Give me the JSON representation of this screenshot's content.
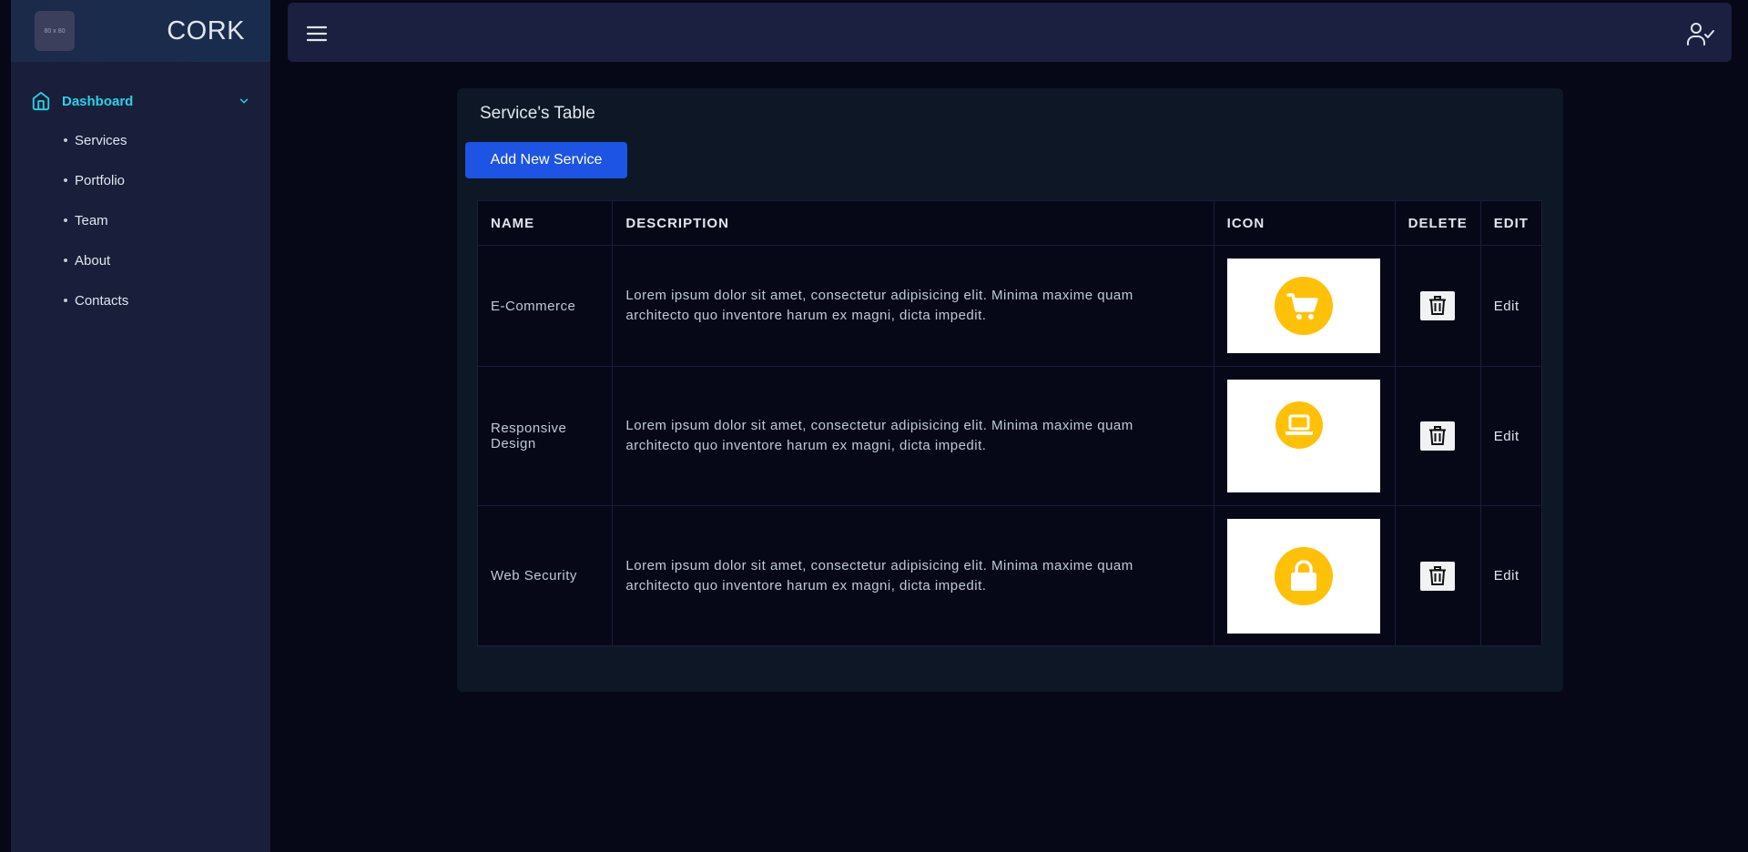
{
  "brand": {
    "logo_text": "80 x 80",
    "name": "CORK"
  },
  "sidebar": {
    "section_label": "Dashboard",
    "items": [
      {
        "label": "Services"
      },
      {
        "label": "Portfolio"
      },
      {
        "label": "Team"
      },
      {
        "label": "About"
      },
      {
        "label": "Contacts"
      }
    ]
  },
  "main": {
    "card_title": "Service's Table",
    "add_button_label": "Add New Service",
    "table": {
      "headers": [
        "NAME",
        "DESCRIPTION",
        "ICON",
        "DELETE",
        "EDIT"
      ],
      "rows": [
        {
          "name": "E-Commerce",
          "description": "Lorem ipsum dolor sit amet, consectetur adipisicing elit. Minima maxime quam architecto quo inventore harum ex magni, dicta impedit.",
          "icon": "shopping-cart-icon",
          "edit_label": "Edit"
        },
        {
          "name": "Responsive Design",
          "description": "Lorem ipsum dolor sit amet, consectetur adipisicing elit. Minima maxime quam architecto quo inventore harum ex magni, dicta impedit.",
          "icon": "laptop-icon",
          "edit_label": "Edit"
        },
        {
          "name": "Web Security",
          "description": "Lorem ipsum dolor sit amet, consectetur adipisicing elit. Minima maxime quam architecto quo inventore harum ex magni, dicta impedit.",
          "icon": "lock-icon",
          "edit_label": "Edit"
        }
      ]
    }
  },
  "colors": {
    "background": "#060818",
    "sidebar": "#191e3a",
    "header": "#1b2040",
    "card": "#0e1726",
    "accent": "#25d5e4",
    "primary_button": "#1d54e3",
    "icon_yellow": "#ffc107"
  }
}
